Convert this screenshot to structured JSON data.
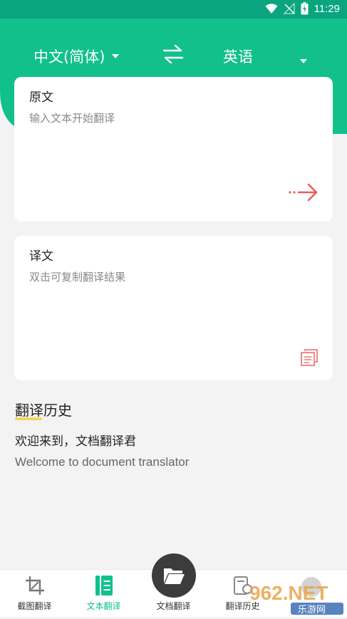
{
  "status_bar": {
    "time": "11:29"
  },
  "languages": {
    "source": "中文(简体)",
    "target": "英语"
  },
  "source_card": {
    "title": "原文",
    "placeholder": "输入文本开始翻译"
  },
  "target_card": {
    "title": "译文",
    "placeholder": "双击可复制翻译结果"
  },
  "history": {
    "title": "翻译历史",
    "items": [
      {
        "source": "欢迎来到，文档翻译君",
        "translation": "Welcome to document translator"
      }
    ]
  },
  "tabs": [
    {
      "label": "截图翻译",
      "icon": "crop-icon",
      "active": false
    },
    {
      "label": "文本翻译",
      "icon": "text-doc-icon",
      "active": true
    },
    {
      "label": "文档翻译",
      "icon": "folder-icon",
      "active": false
    },
    {
      "label": "翻译历史",
      "icon": "history-icon",
      "active": false
    }
  ],
  "watermark": {
    "text": "962.NET",
    "subtext": "乐游网"
  },
  "colors": {
    "primary": "#12c08c",
    "status_bar": "#0aa57f",
    "accent_arrow": "#f05a5a",
    "highlight": "#f7d65a"
  }
}
